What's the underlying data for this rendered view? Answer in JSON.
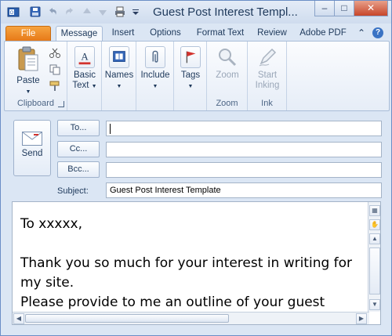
{
  "window": {
    "title": "Guest Post Interest Templ...",
    "controls": {
      "minimize": "–",
      "maximize": "□",
      "close": "✕"
    }
  },
  "tabs": [
    {
      "label": "File"
    },
    {
      "label": "Message"
    },
    {
      "label": "Insert"
    },
    {
      "label": "Options"
    },
    {
      "label": "Format Text"
    },
    {
      "label": "Review"
    },
    {
      "label": "Adobe PDF"
    }
  ],
  "ribbon": {
    "clipboard": {
      "paste": "Paste",
      "group": "Clipboard"
    },
    "basic_text": {
      "line1": "Basic",
      "line2": "Text"
    },
    "names": {
      "label": "Names"
    },
    "include": {
      "label": "Include"
    },
    "tags": {
      "label": "Tags"
    },
    "zoom": {
      "button": "Zoom",
      "group": "Zoom"
    },
    "ink": {
      "line1": "Start",
      "line2": "Inking",
      "group": "Ink"
    }
  },
  "header": {
    "send": "Send",
    "to_button": "To...",
    "cc_button": "Cc...",
    "bcc_button": "Bcc...",
    "to_value": "",
    "cc_value": "",
    "bcc_value": "",
    "subject_label": "Subject:",
    "subject_value": "Guest Post Interest Template"
  },
  "body": {
    "greeting": "To xxxxx,",
    "line1": "Thank you so much for your interest in writing for my site.",
    "line2": "Please provide to me an outline of your guest"
  },
  "colors": {
    "file_tab": "#e67716",
    "frame": "#dbe6f4",
    "accent_text": "#1e395b"
  }
}
